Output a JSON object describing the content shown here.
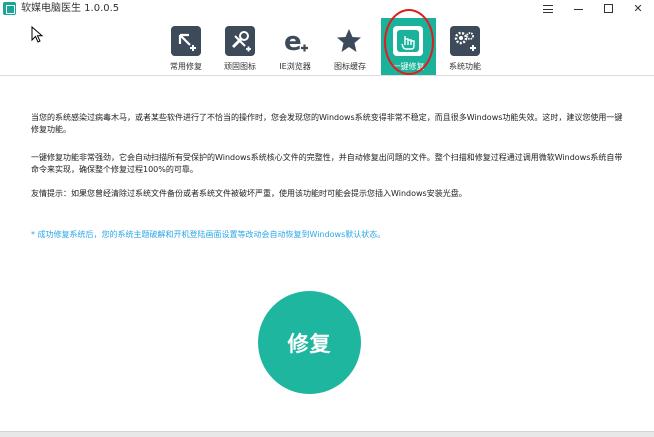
{
  "window": {
    "title": "软媒电脑医生 1.0.0.5",
    "controls": {
      "menu": "hamburger-icon",
      "minimize": "minimize-icon",
      "maximize": "maximize-icon",
      "close": "✕"
    }
  },
  "toolbar": {
    "active_color": "#1ab29b",
    "items": [
      {
        "label": "常用修复",
        "icon": "common-repair-icon"
      },
      {
        "label": "顽固图标",
        "icon": "tools-icon"
      },
      {
        "label": "IE浏览器",
        "icon": "ie-icon"
      },
      {
        "label": "图标缓存",
        "icon": "star-icon"
      },
      {
        "label": "一键修复",
        "icon": "one-click-repair-icon",
        "active": true
      },
      {
        "label": "系统功能",
        "icon": "gears-icon"
      }
    ]
  },
  "content": {
    "para1": "当您的系统感染过病毒木马，或者某些软件进行了不恰当的操作时，您会发现您的Windows系统变得非常不稳定，而且很多Windows功能失效。这时，建议您使用一键修复功能。",
    "para2": "一键修复功能非常强劲，它会自动扫描所有受保护的Windows系统核心文件的完整性，并自动修复出问题的文件。整个扫描和修复过程通过调用微软Windows系统自带命令来实现，确保整个修复过程100%的可靠。",
    "para3": "友情提示：如果您曾经清除过系统文件备份或者系统文件被破坏严重，使用该功能时可能会提示您插入Windows安装光盘。",
    "note": "* 成功修复系统后，您的系统主题破解和开机登陆画面设置等改动会自动恢复到Windows默认状态。"
  },
  "repair_button": {
    "label": "修复",
    "color": "#1fb69f"
  }
}
